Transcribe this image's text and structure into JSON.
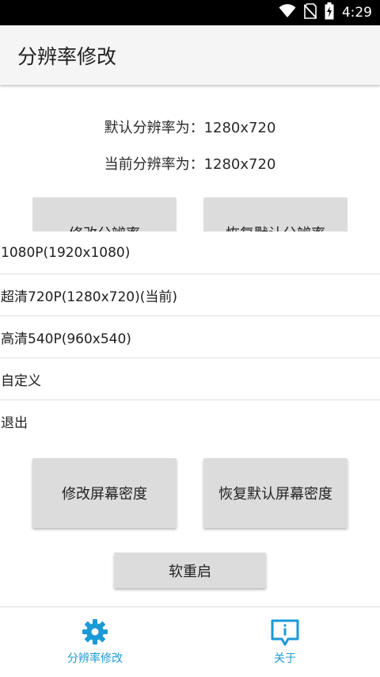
{
  "status_bar": {
    "time": "4:29",
    "icons": [
      "wifi-icon",
      "no-sim-icon",
      "battery-charging-icon"
    ]
  },
  "app_bar": {
    "title": "分辨率修改"
  },
  "info": {
    "default_resolution": "默认分辨率为：1280x720",
    "current_resolution": "当前分辨率为：1280x720"
  },
  "buttons": {
    "modify_resolution": "修改分辨率",
    "restore_resolution": "恢复默认分辨率",
    "modify_density": "修改屏幕密度",
    "restore_density": "恢复默认屏幕密度",
    "soft_reboot": "软重启"
  },
  "menu": {
    "items": [
      "1080P(1920x1080)",
      "超清720P(1280x720)(当前)",
      "高清540P(960x540)",
      "自定义",
      "退出"
    ]
  },
  "bottom_nav": {
    "tabs": [
      {
        "label": "分辨率修改",
        "icon": "gear-icon"
      },
      {
        "label": "关于",
        "icon": "info-bubble-icon"
      }
    ]
  },
  "colors": {
    "accent": "#1a9ad6",
    "button": "#dcdcdc",
    "app_bar": "#f5f5f5",
    "status_bar": "#000000"
  }
}
